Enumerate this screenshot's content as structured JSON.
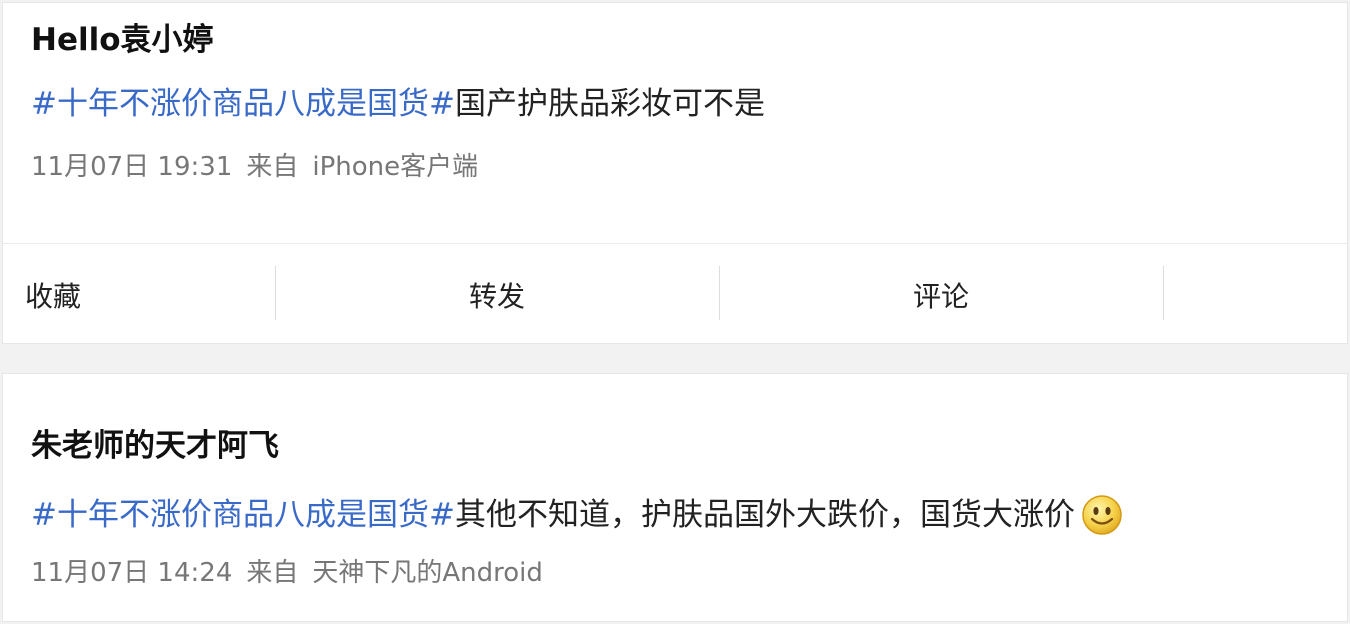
{
  "posts": [
    {
      "author": "Hello袁小婷",
      "topic": "#十年不涨价商品八成是国货#",
      "text": "国产护肤品彩妆可不是",
      "time": "11月07日 19:31",
      "from_label": "来自",
      "source": "iPhone客户端",
      "actions": {
        "favorite": "收藏",
        "repost": "转发",
        "comment": "评论"
      }
    },
    {
      "author": "朱老师的天才阿飞",
      "topic": "#十年不涨价商品八成是国货#",
      "text": "其他不知道，护肤品国外大跌价，国货大涨价",
      "emoji": "smile-emoji-icon",
      "time": "11月07日 14:24",
      "from_label": "来自",
      "source": "天神下凡的Android"
    }
  ],
  "colors": {
    "topic_link": "#3a6ac8",
    "meta_text": "#777777",
    "page_bg": "#f2f2f2"
  }
}
